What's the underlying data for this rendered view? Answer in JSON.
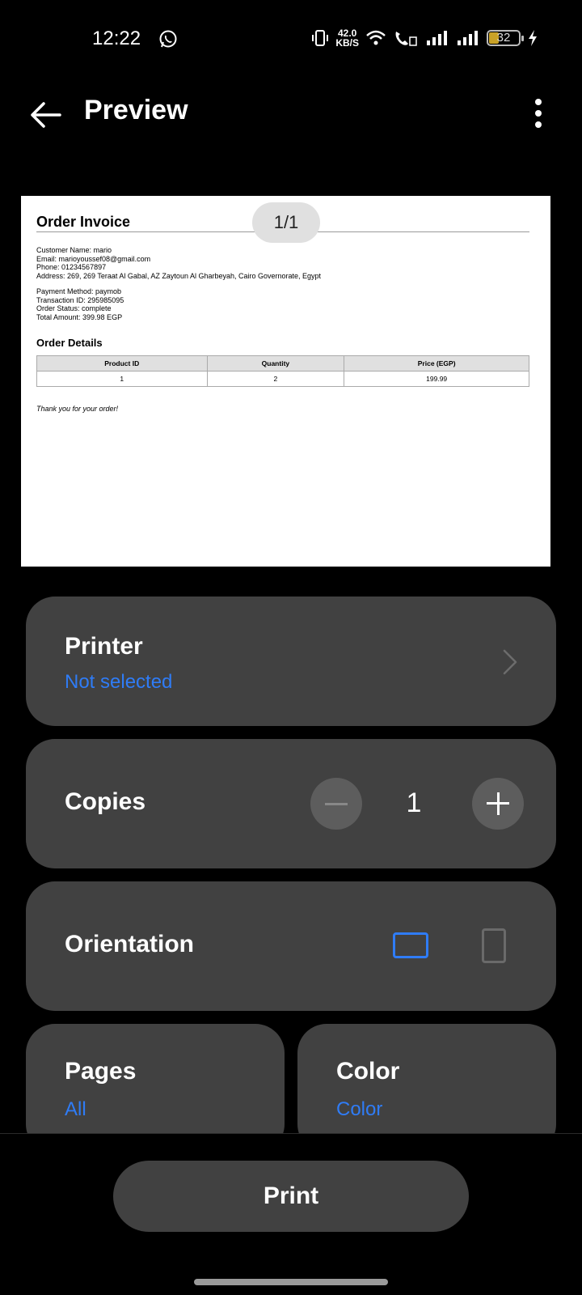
{
  "status_bar": {
    "time": "12:22",
    "net_speed_value": "42.0",
    "net_speed_unit": "KB/S",
    "battery": "32",
    "icons": [
      "whatsapp-icon",
      "vibrate-icon",
      "wifi-icon",
      "wifi-calling-icon",
      "signal-icon",
      "signal-icon",
      "battery-icon",
      "charging-icon"
    ]
  },
  "app_bar": {
    "title": "Preview",
    "back_icon": "arrow-left-icon",
    "menu_icon": "more-vertical-icon"
  },
  "preview": {
    "page_indicator": "1/1",
    "document": {
      "title": "Order Invoice",
      "customer_lines": [
        "Customer Name: mario",
        "Email: marioyoussef08@gmail.com",
        "Phone: 01234567897",
        "Address: 269, 269 Teraat Al Gabal, AZ Zaytoun Al Gharbeyah, Cairo Governorate, Egypt"
      ],
      "payment_lines": [
        "Payment Method: paymob",
        "Transaction ID: 295985095",
        "Order Status: complete",
        "Total Amount: 399.98 EGP"
      ],
      "details_heading": "Order Details",
      "table": {
        "headers": [
          "Product ID",
          "Quantity",
          "Price (EGP)"
        ],
        "rows": [
          [
            "1",
            "2",
            "199.99"
          ]
        ]
      },
      "footer": "Thank you for your order!"
    }
  },
  "settings": {
    "printer": {
      "label": "Printer",
      "value": "Not selected"
    },
    "copies": {
      "label": "Copies",
      "value": "1"
    },
    "orientation": {
      "label": "Orientation",
      "selected": "landscape"
    },
    "pages": {
      "label": "Pages",
      "value": "All"
    },
    "color": {
      "label": "Color",
      "value": "Color"
    }
  },
  "actions": {
    "print_label": "Print"
  },
  "colors": {
    "accent": "#2f7cf6",
    "card_bg": "#414141",
    "background": "#000000"
  }
}
